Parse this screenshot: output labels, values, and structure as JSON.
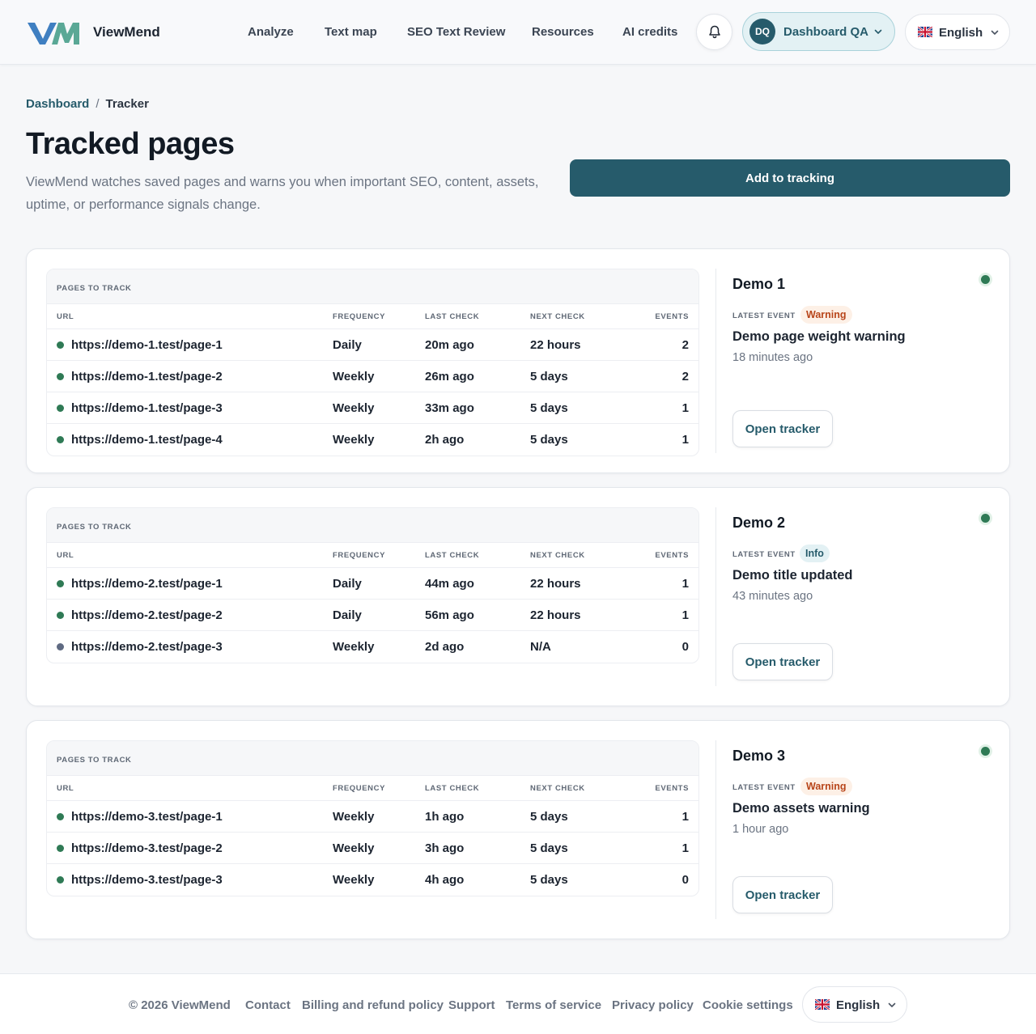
{
  "header": {
    "brand": "ViewMend",
    "nav": [
      {
        "label": "Analyze"
      },
      {
        "label": "Text map"
      },
      {
        "label": "SEO Text Review"
      },
      {
        "label": "Resources"
      },
      {
        "label": "AI credits"
      }
    ],
    "notifications_icon": "bell-icon",
    "account": {
      "initials": "DQ",
      "name": "Dashboard QA"
    },
    "language": {
      "label": "English",
      "flag": "uk-flag-icon"
    }
  },
  "breadcrumb": {
    "dashboard": "Dashboard",
    "separator": "/",
    "current": "Tracker"
  },
  "page": {
    "title": "Tracked pages",
    "description": "ViewMend watches saved pages and warns you when important SEO, content, assets, uptime, or performance signals change.",
    "add_button": "Add to tracking"
  },
  "table_labels": {
    "section": "PAGES TO TRACK",
    "url": "URL",
    "frequency": "FREQUENCY",
    "last_check": "LAST CHECK",
    "next_check": "NEXT CHECK",
    "events": "EVENTS",
    "latest_event": "LATEST EVENT",
    "open_tracker": "Open tracker"
  },
  "colors": {
    "accent": "#265b6b",
    "status_active": "#2f7a55",
    "status_paused": "#5f6a82",
    "warning_text": "#b8451a",
    "warning_bg": "#fdf0e6",
    "info_text": "#265b6b",
    "info_bg": "#e3f1f4"
  },
  "trackers": [
    {
      "name": "Demo 1",
      "event_badge": "Warning",
      "event_type": "warning",
      "event_title": "Demo page weight warning",
      "event_time": "18 minutes ago",
      "pages": [
        {
          "url": "https://demo-1.test/page-1",
          "frequency": "Daily",
          "last_check": "20m ago",
          "next_check": "22 hours",
          "events": "2",
          "status": "active"
        },
        {
          "url": "https://demo-1.test/page-2",
          "frequency": "Weekly",
          "last_check": "26m ago",
          "next_check": "5 days",
          "events": "2",
          "status": "active"
        },
        {
          "url": "https://demo-1.test/page-3",
          "frequency": "Weekly",
          "last_check": "33m ago",
          "next_check": "5 days",
          "events": "1",
          "status": "active"
        },
        {
          "url": "https://demo-1.test/page-4",
          "frequency": "Weekly",
          "last_check": "2h ago",
          "next_check": "5 days",
          "events": "1",
          "status": "active"
        }
      ]
    },
    {
      "name": "Demo 2",
      "event_badge": "Info",
      "event_type": "info",
      "event_title": "Demo title updated",
      "event_time": "43 minutes ago",
      "pages": [
        {
          "url": "https://demo-2.test/page-1",
          "frequency": "Daily",
          "last_check": "44m ago",
          "next_check": "22 hours",
          "events": "1",
          "status": "active"
        },
        {
          "url": "https://demo-2.test/page-2",
          "frequency": "Daily",
          "last_check": "56m ago",
          "next_check": "22 hours",
          "events": "1",
          "status": "active"
        },
        {
          "url": "https://demo-2.test/page-3",
          "frequency": "Weekly",
          "last_check": "2d ago",
          "next_check": "N/A",
          "events": "0",
          "status": "paused"
        }
      ]
    },
    {
      "name": "Demo 3",
      "event_badge": "Warning",
      "event_type": "warning",
      "event_title": "Demo assets warning",
      "event_time": "1 hour ago",
      "pages": [
        {
          "url": "https://demo-3.test/page-1",
          "frequency": "Weekly",
          "last_check": "1h ago",
          "next_check": "5 days",
          "events": "1",
          "status": "active"
        },
        {
          "url": "https://demo-3.test/page-2",
          "frequency": "Weekly",
          "last_check": "3h ago",
          "next_check": "5 days",
          "events": "1",
          "status": "active"
        },
        {
          "url": "https://demo-3.test/page-3",
          "frequency": "Weekly",
          "last_check": "4h ago",
          "next_check": "5 days",
          "events": "0",
          "status": "active"
        }
      ]
    }
  ],
  "footer": {
    "copyright": "© 2026 ViewMend",
    "links": [
      {
        "label": "Contact"
      },
      {
        "label": "Billing and refund policy"
      },
      {
        "label": "Support"
      },
      {
        "label": "Terms of service"
      },
      {
        "label": "Privacy policy"
      },
      {
        "label": "Cookie settings"
      }
    ],
    "language": {
      "label": "English",
      "flag": "uk-flag-icon"
    }
  }
}
